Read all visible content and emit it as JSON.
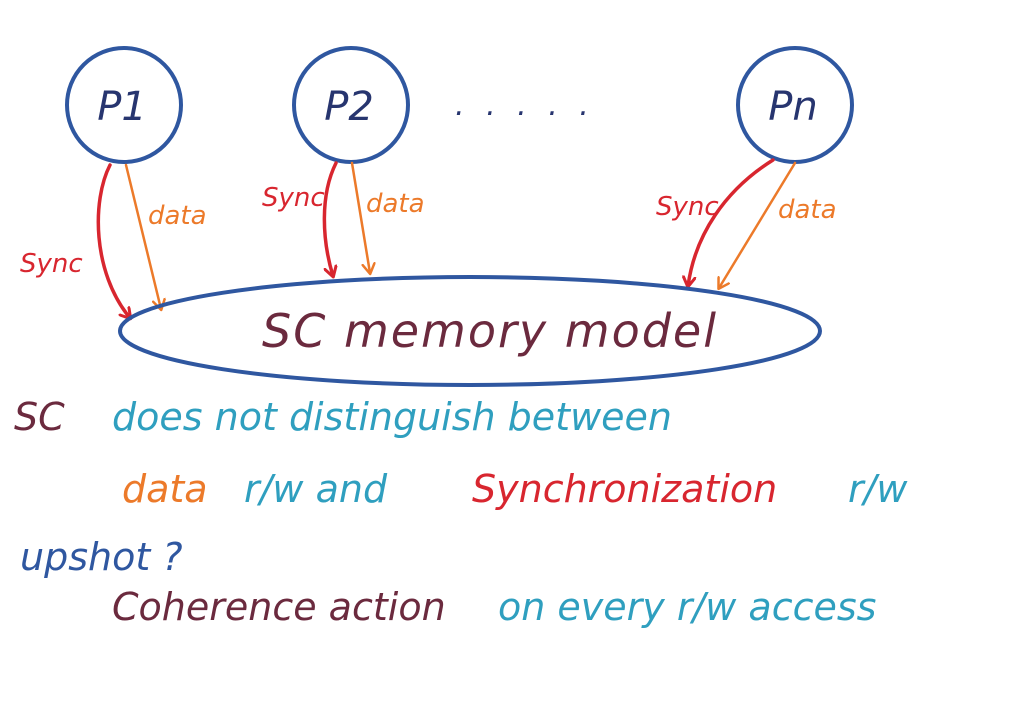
{
  "processors": [
    {
      "label": "P1"
    },
    {
      "label": "P2"
    },
    {
      "label": "Pn"
    }
  ],
  "ellipsis": ". . . . .",
  "edge_labels": {
    "sync": "Sync",
    "data": "data"
  },
  "memory_model": {
    "label": "SC memory model"
  },
  "notes": {
    "line1": {
      "part1": "SC",
      "part2": "does not distinguish between"
    },
    "line2": {
      "part1": "data",
      "part2": "r/w and",
      "part3": "Synchronization",
      "part4": "r/w"
    },
    "line3": "upshot ?",
    "line4": {
      "part1": "Coherence action",
      "part2": "on every r/w access"
    }
  },
  "colors": {
    "circle_stroke": "#2f57a0",
    "sync_arrow": "#d8262f",
    "data_arrow": "#ec7a2a",
    "processor_text": "#27356f",
    "maroon_text": "#6b2a3e",
    "teal_text": "#2f9fbf",
    "navy_text": "#2f57a0"
  }
}
